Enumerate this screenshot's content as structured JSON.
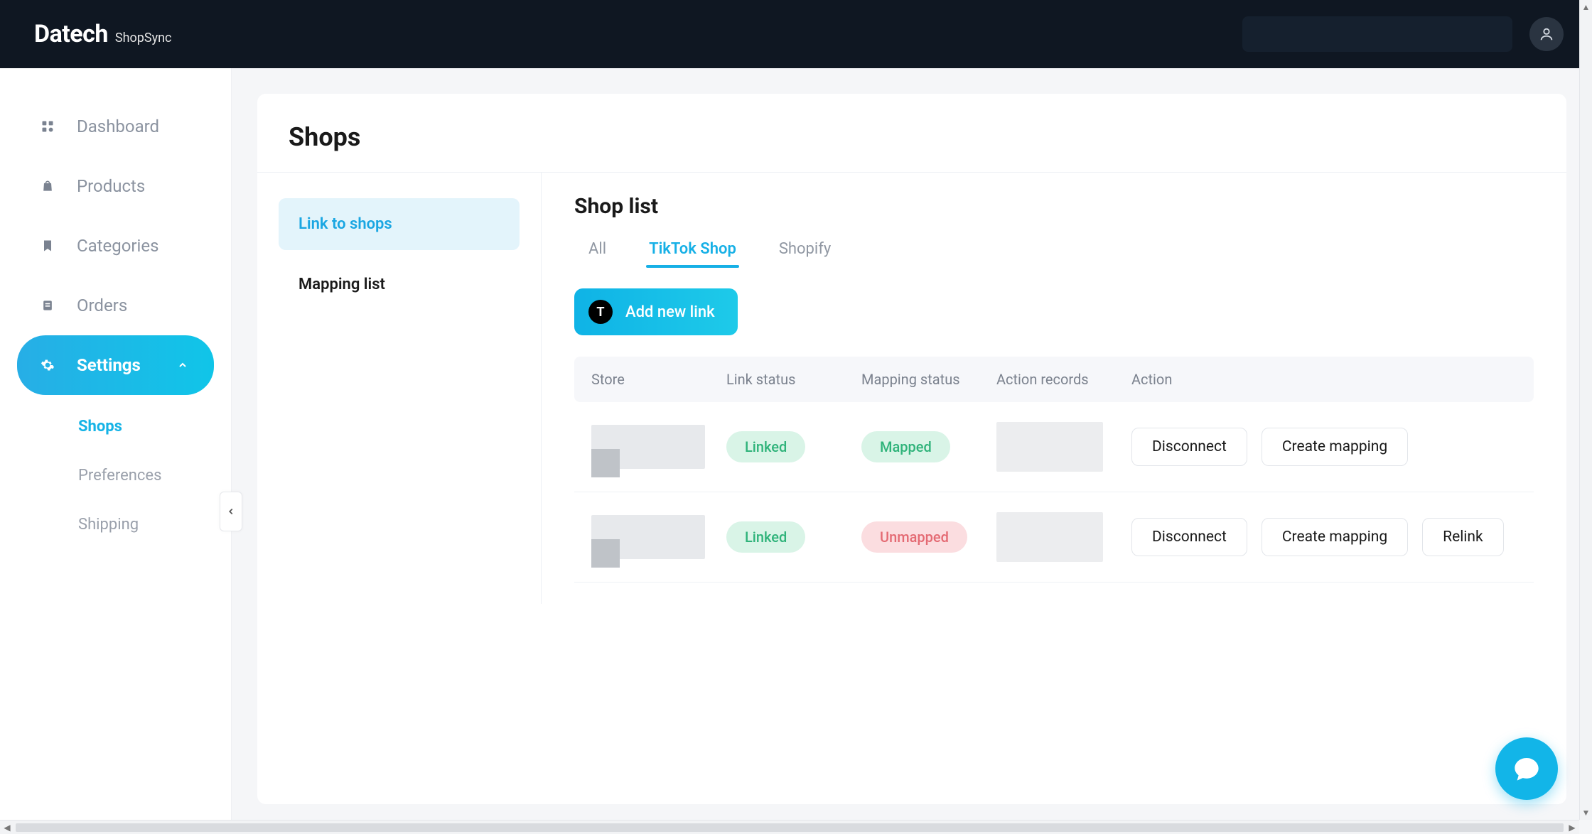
{
  "brand": {
    "main": "Datech",
    "sub": "ShopSync"
  },
  "sidebar": {
    "items": [
      {
        "label": "Dashboard"
      },
      {
        "label": "Products"
      },
      {
        "label": "Categories"
      },
      {
        "label": "Orders"
      },
      {
        "label": "Settings"
      }
    ],
    "settings_sub": [
      {
        "label": "Shops"
      },
      {
        "label": "Preferences"
      },
      {
        "label": "Shipping"
      }
    ]
  },
  "page": {
    "title": "Shops",
    "left_tabs": {
      "link": "Link to shops",
      "mapping": "Mapping list"
    },
    "section_title": "Shop list",
    "tabs": {
      "all": "All",
      "tiktok": "TikTok Shop",
      "shopify": "Shopify"
    },
    "add_link": {
      "badge": "T",
      "label": "Add new link"
    },
    "columns": {
      "store": "Store",
      "link_status": "Link status",
      "mapping_status": "Mapping status",
      "action_records": "Action records",
      "action": "Action"
    },
    "status": {
      "linked": "Linked",
      "mapped": "Mapped",
      "unmapped": "Unmapped"
    },
    "actions": {
      "disconnect": "Disconnect",
      "create_mapping": "Create mapping",
      "relink": "Relink"
    },
    "rows": [
      {
        "link_status": "linked",
        "mapping_status": "mapped",
        "actions": [
          "disconnect",
          "create_mapping"
        ]
      },
      {
        "link_status": "linked",
        "mapping_status": "unmapped",
        "actions": [
          "disconnect",
          "create_mapping",
          "relink"
        ]
      }
    ]
  }
}
